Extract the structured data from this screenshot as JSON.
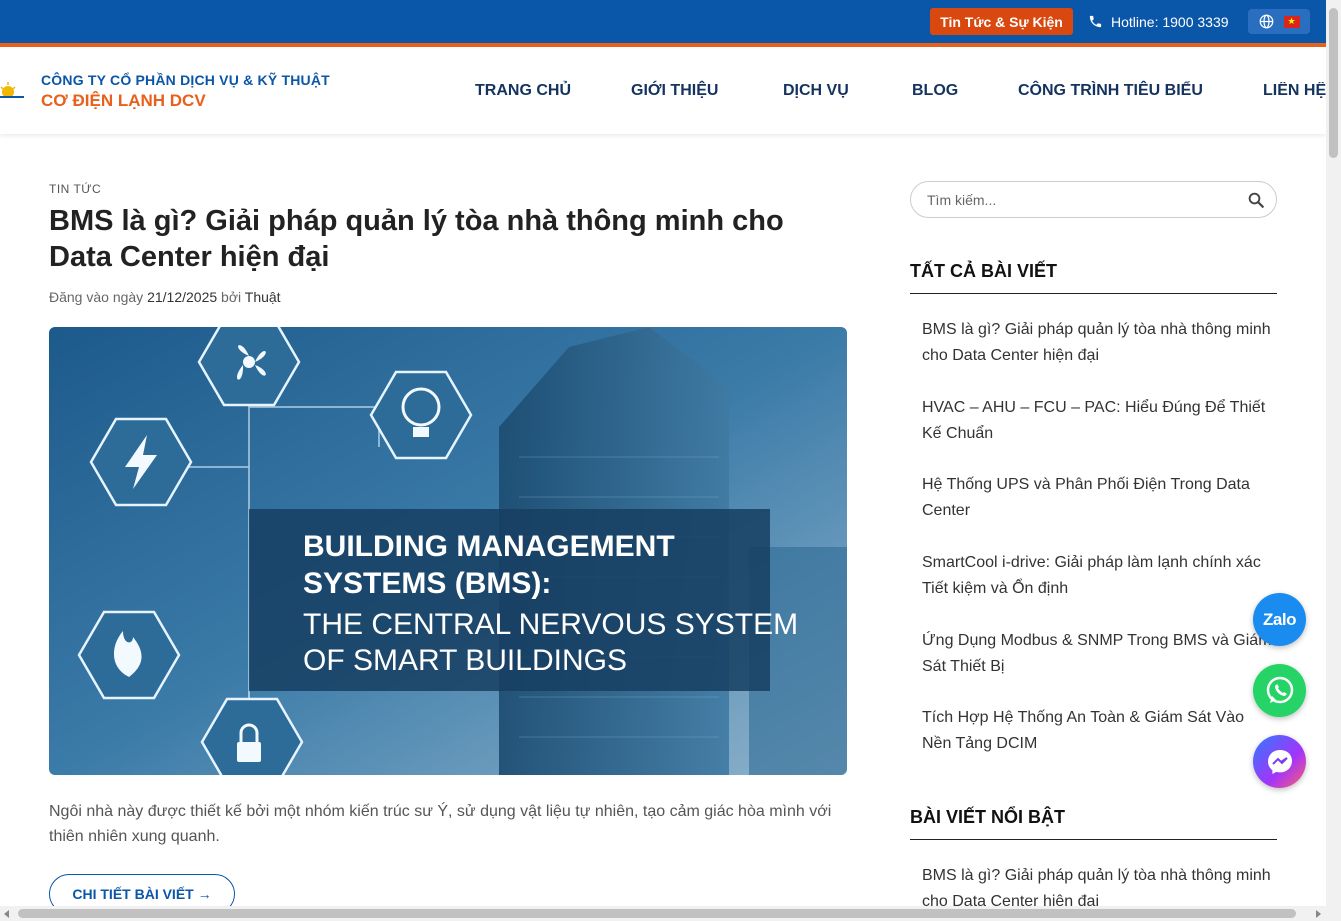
{
  "topbar": {
    "news_label": "Tin Tức & Sự Kiện",
    "hotline": "Hotline: 1900 3339",
    "flag_star": "★"
  },
  "header": {
    "company_line1": "CÔNG TY CỔ PHẦN DỊCH VỤ & KỸ THUẬT",
    "company_line2": "CƠ ĐIỆN LẠNH DCV",
    "nav": [
      "TRANG CHỦ",
      "GIỚI THIỆU",
      "DỊCH VỤ",
      "BLOG",
      "CÔNG TRÌNH TIÊU BIỂU",
      "LIÊN HỆ"
    ]
  },
  "post": {
    "category": "TIN TỨC",
    "title": "BMS là gì? Giải pháp quản lý tòa nhà thông minh cho Data Center hiện đại",
    "meta_prefix": "Đăng vào ngày ",
    "date": "21/12/2025",
    "meta_by": " bởi ",
    "author": "Thuật",
    "hero": {
      "line1": "BUILDING MANAGEMENT",
      "line2": "SYSTEMS (BMS):",
      "line3": "THE CENTRAL NERVOUS SYSTEM",
      "line4": "OF SMART BUILDINGS"
    },
    "excerpt": "Ngôi nhà này được thiết kế bởi một nhóm kiến trúc sư Ý, sử dụng vật liệu tự nhiên, tạo cảm giác hòa mình với thiên nhiên xung quanh.",
    "more_label": "CHI TIẾT BÀI VIẾT →"
  },
  "sidebar": {
    "search_placeholder": "Tìm kiếm...",
    "all_posts_heading": "TẤT CẢ BÀI VIẾT",
    "all_posts": [
      "BMS là gì? Giải pháp quản lý tòa nhà thông minh cho Data Center hiện đại",
      "HVAC – AHU – FCU – PAC: Hiểu Đúng Để Thiết Kế Chuẩn",
      "Hệ Thống UPS và Phân Phối Điện Trong Data Center",
      "SmartCool i-drive: Giải pháp làm lạnh chính xác Tiết kiệm và Ổn định",
      "Ứng Dụng Modbus & SNMP Trong BMS và Giám Sát Thiết Bị",
      "Tích Hợp Hệ Thống An Toàn & Giám Sát Vào Nền Tảng DCIM"
    ],
    "featured_heading": "BÀI VIẾT NỔI BẬT",
    "featured": [
      "BMS là gì? Giải pháp quản lý tòa nhà thông minh cho Data Center hiện đại"
    ]
  },
  "floating": {
    "zalo_label": "Zalo"
  },
  "colors": {
    "brand_blue": "#0a56a8",
    "brand_orange": "#e8601c",
    "news_button": "#d9480f",
    "zalo": "#1a8cf0",
    "whatsapp": "#25d366"
  }
}
